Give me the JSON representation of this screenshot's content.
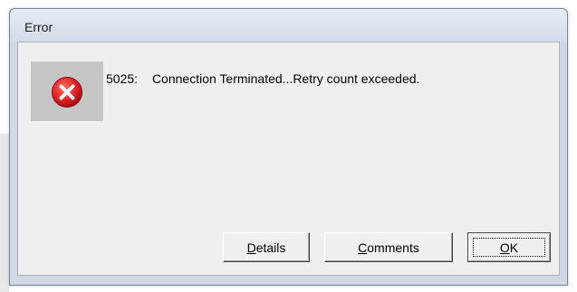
{
  "window": {
    "title": "Error"
  },
  "icon": {
    "name": "error-icon",
    "glyph": "×",
    "color": "#e3262a"
  },
  "message": {
    "code": "5025:",
    "text": "Connection Terminated...Retry count exceeded."
  },
  "buttons": {
    "details": {
      "accel": "D",
      "rest": "etails"
    },
    "comments": {
      "accel": "C",
      "rest": "omments"
    },
    "ok": {
      "accel": "O",
      "rest": "K"
    }
  }
}
